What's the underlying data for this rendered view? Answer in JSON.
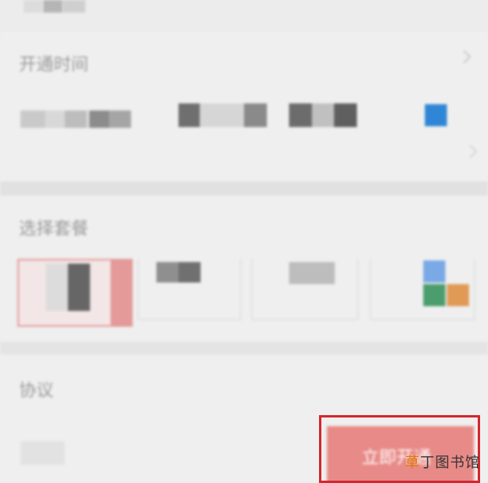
{
  "section_time": {
    "label": "开通时间"
  },
  "section_plan": {
    "label": "选择套餐"
  },
  "section_other": {
    "label": "协议"
  },
  "cta": {
    "label": "立即开通"
  },
  "watermark": {
    "accent": "草",
    "rest": "丁图书馆"
  },
  "colors": {
    "selected_accent": "#e39a98",
    "primary_blue": "#2f86d6",
    "tile_blue": "#7aa9e6",
    "tile_green": "#4b9d6d",
    "tile_orange": "#e19a55",
    "cta_bg": "#e88a87",
    "highlight_frame": "#d4272d"
  },
  "icons": [
    "chevron-right-icon",
    "checkbox-checked-icon",
    "app-grid-icon"
  ]
}
